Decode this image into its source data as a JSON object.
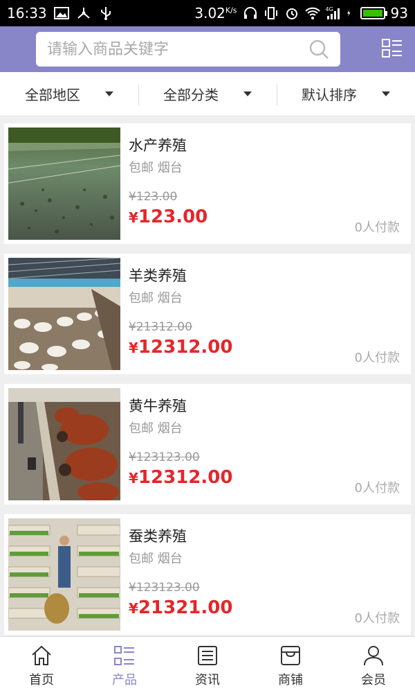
{
  "status_bar": {
    "time": "16:33",
    "network_speed": "3.02",
    "network_speed_unit": "K/s",
    "battery": "93",
    "signal_label": "4G"
  },
  "search": {
    "placeholder": "请输入商品关键字"
  },
  "filters": [
    {
      "label": "全部地区"
    },
    {
      "label": "全部分类"
    },
    {
      "label": "默认排序"
    }
  ],
  "products": [
    {
      "name": "水产养殖",
      "meta": "包邮 烟台",
      "original_price": "¥123.00",
      "price_symbol": "¥",
      "price": "123.00",
      "sales": "0人付款"
    },
    {
      "name": "羊类养殖",
      "meta": "包邮 烟台",
      "original_price": "¥21312.00",
      "price_symbol": "¥",
      "price": "12312.00",
      "sales": "0人付款"
    },
    {
      "name": "黄牛养殖",
      "meta": "包邮 烟台",
      "original_price": "¥123123.00",
      "price_symbol": "¥",
      "price": "12312.00",
      "sales": "0人付款"
    },
    {
      "name": "蚕类养殖",
      "meta": "包邮 烟台",
      "original_price": "¥123123.00",
      "price_symbol": "¥",
      "price": "21321.00",
      "sales": "0人付款"
    }
  ],
  "nav": [
    {
      "label": "首页",
      "icon": "home-icon"
    },
    {
      "label": "产品",
      "icon": "list-icon",
      "active": true
    },
    {
      "label": "资讯",
      "icon": "news-icon"
    },
    {
      "label": "商铺",
      "icon": "store-icon"
    },
    {
      "label": "会员",
      "icon": "user-icon"
    }
  ],
  "colors": {
    "header": "#8985c9",
    "price": "#e5262b",
    "nav_active": "#8985c9"
  }
}
